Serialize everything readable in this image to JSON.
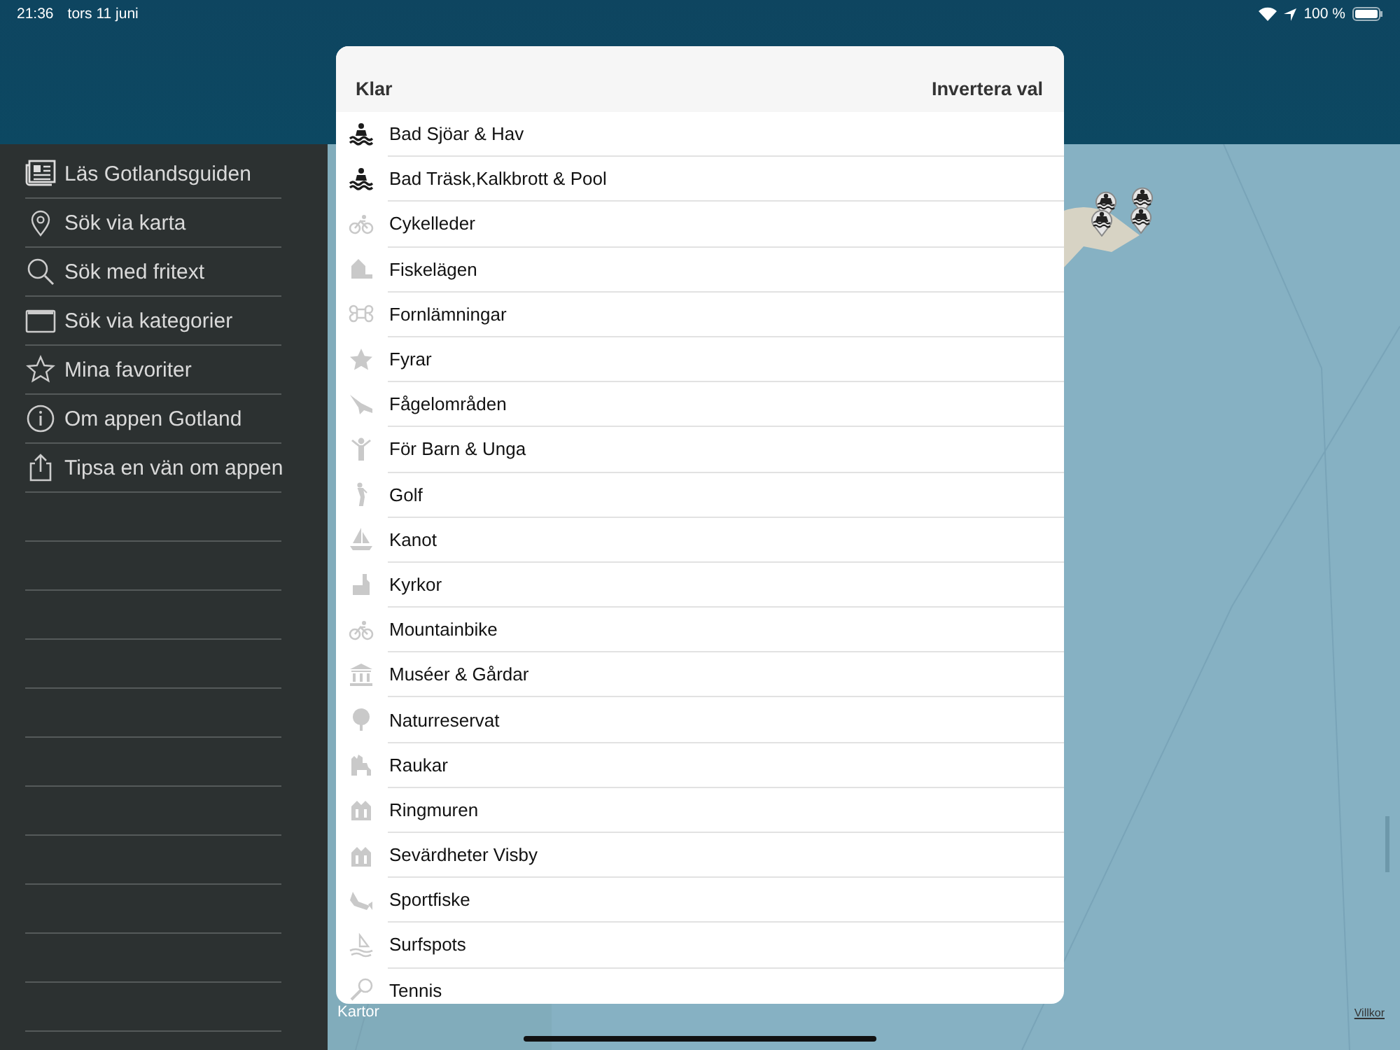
{
  "status_bar": {
    "time": "21:36",
    "date": "tors 11 juni",
    "battery": "100 %"
  },
  "sidebar": {
    "items": [
      {
        "label": "Läs Gotlandsguiden"
      },
      {
        "label": "Sök via karta"
      },
      {
        "label": "Sök med fritext"
      },
      {
        "label": "Sök via kategorier"
      },
      {
        "label": "Mina favoriter"
      },
      {
        "label": "Om appen Gotland"
      },
      {
        "label": "Tipsa en vän om appen"
      }
    ]
  },
  "map": {
    "attribution": "Kartor",
    "terms_link": "Villkor"
  },
  "sheet": {
    "done_button": "Klar",
    "invert_button": "Invertera val",
    "items": [
      {
        "label": "Bad Sjöar & Hav",
        "selected": true
      },
      {
        "label": "Bad Träsk,Kalkbrott & Pool",
        "selected": true
      },
      {
        "label": "Cykelleder",
        "selected": false
      },
      {
        "label": "Fiskelägen",
        "selected": false
      },
      {
        "label": "Fornlämningar",
        "selected": false
      },
      {
        "label": "Fyrar",
        "selected": false
      },
      {
        "label": "Fågelområden",
        "selected": false
      },
      {
        "label": "För Barn & Unga",
        "selected": false
      },
      {
        "label": "Golf",
        "selected": false
      },
      {
        "label": "Kanot",
        "selected": false
      },
      {
        "label": "Kyrkor",
        "selected": false
      },
      {
        "label": "Mountainbike",
        "selected": false
      },
      {
        "label": "Muséer & Gårdar",
        "selected": false
      },
      {
        "label": "Naturreservat",
        "selected": false
      },
      {
        "label": "Raukar",
        "selected": false
      },
      {
        "label": "Ringmuren",
        "selected": false
      },
      {
        "label": "Sevärdheter Visby",
        "selected": false
      },
      {
        "label": "Sportfiske",
        "selected": false
      },
      {
        "label": "Surfspots",
        "selected": false
      },
      {
        "label": "Tennis",
        "selected": false
      }
    ]
  }
}
